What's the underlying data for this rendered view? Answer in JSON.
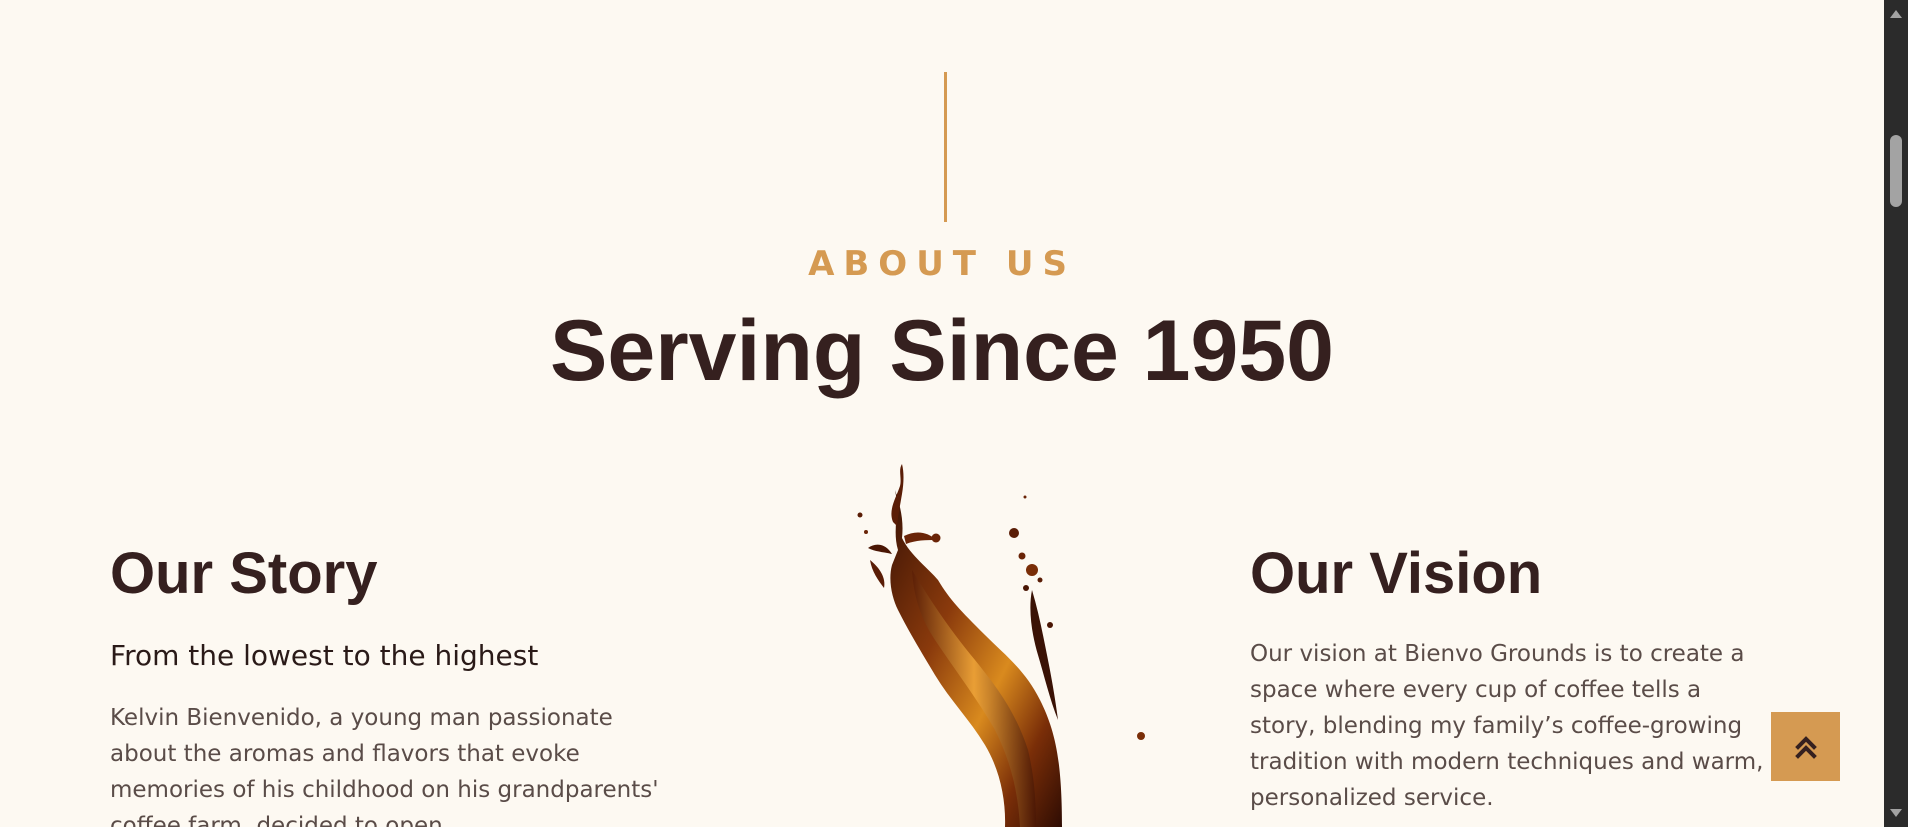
{
  "about": {
    "eyebrow": "ABOUT US",
    "title": "Serving Since 1950"
  },
  "story": {
    "heading": "Our Story",
    "subheading": "From the lowest to the highest",
    "text": "Kelvin Bienvenido, a young man passionate about the aromas and flavors that evoke memories of his childhood on his grandparents' coffee farm, decided to open"
  },
  "vision": {
    "heading": "Our Vision",
    "text": "Our vision at Bienvo Grounds is to create a space where every cup of coffee tells a story, blending my family’s coffee-growing tradition with modern techniques and warm, personalized service."
  },
  "colors": {
    "accent": "#d59a52",
    "heading": "#35201f",
    "body_text": "#5a4c48",
    "background": "#fdf9f2"
  },
  "icons": {
    "scroll_top": "double-chevron-up-icon",
    "splash_image": "coffee-splash"
  }
}
